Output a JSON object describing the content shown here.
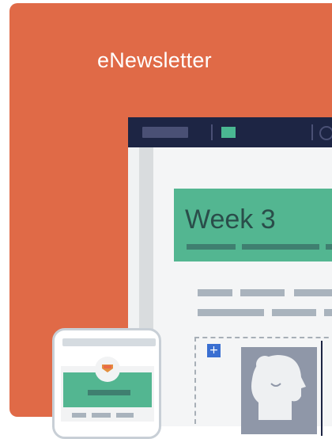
{
  "card": {
    "title": "eNewsletter",
    "background_color": "#e06a47"
  },
  "newsletter_preview": {
    "heading": "Week 3",
    "accent_color": "#53b691",
    "toolbar_color": "#1d2544",
    "add_icon": "plus-icon",
    "add_label": "+",
    "image_icon": "portrait-icon"
  },
  "phone_preview": {
    "badge_icon": "award-ribbon-icon"
  }
}
